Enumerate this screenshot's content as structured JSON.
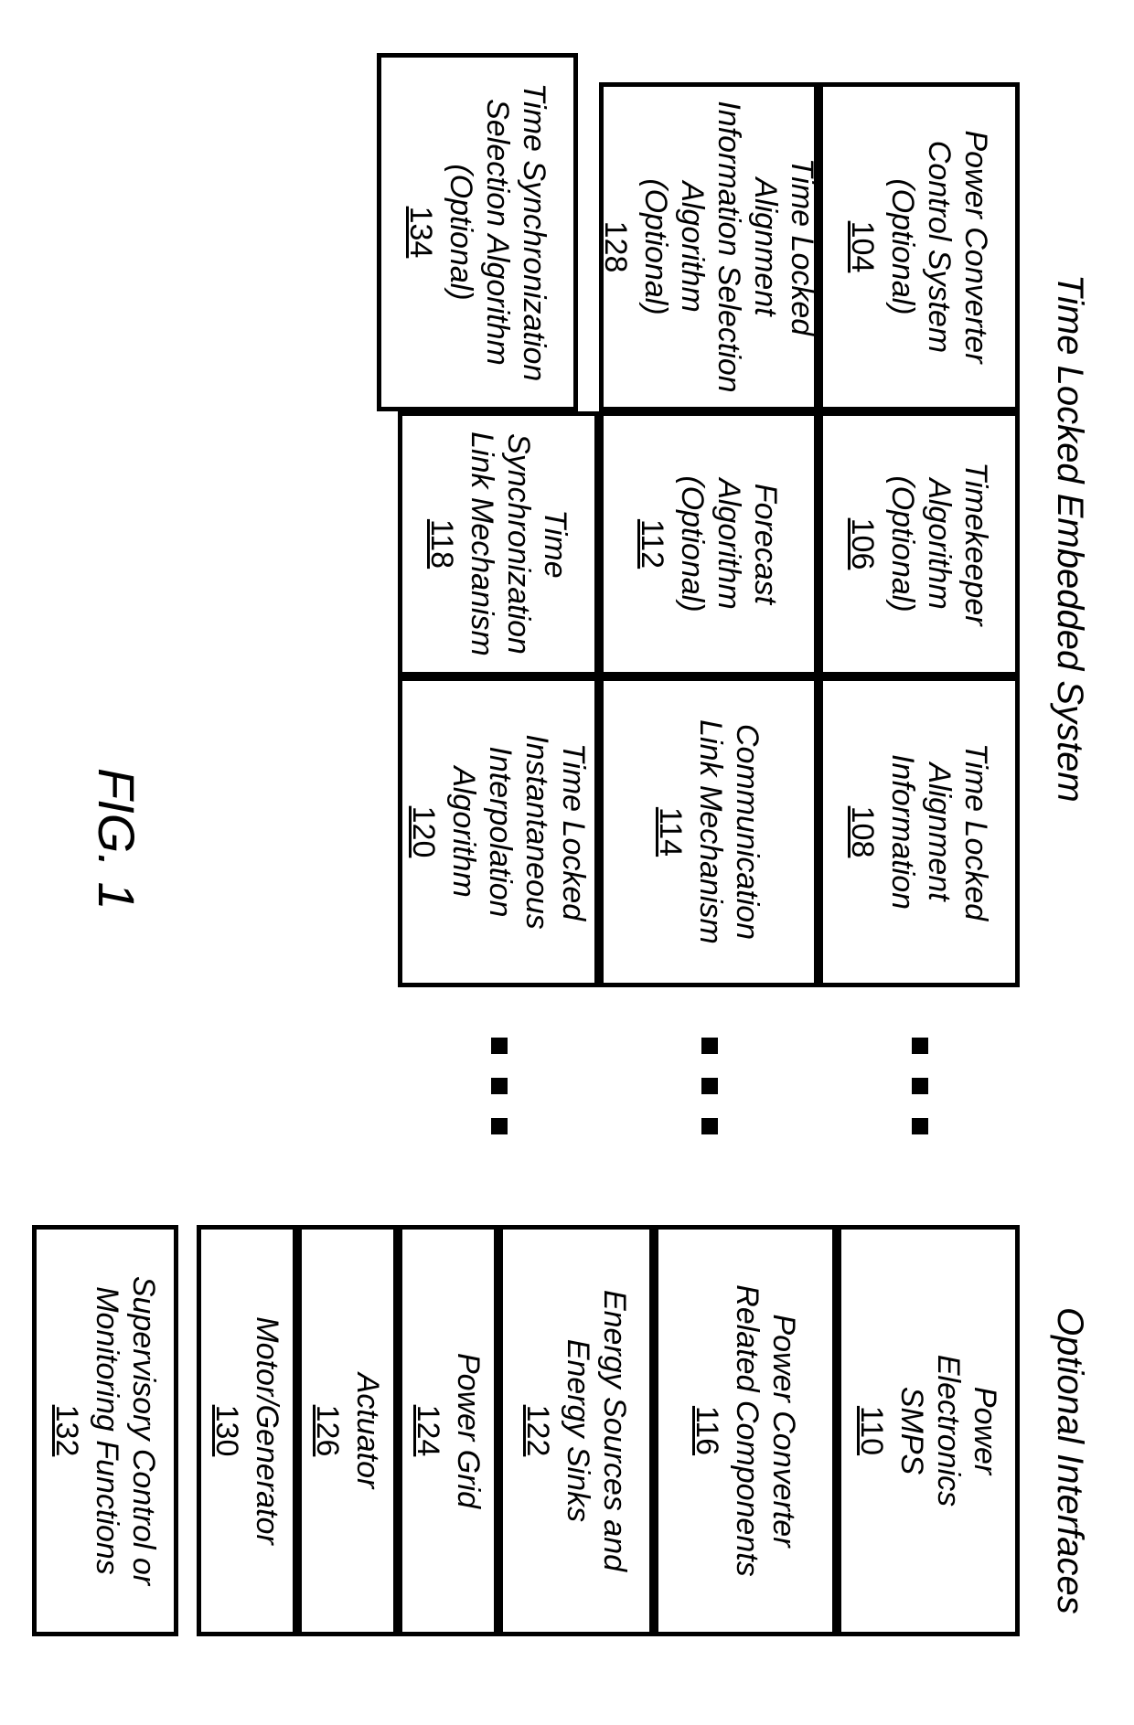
{
  "headings": {
    "left": "Time Locked Embedded System",
    "right": "Optional Interfaces"
  },
  "figure": "FIG. 1",
  "left_grid": {
    "r1c1": {
      "label": "Power Converter\nControl System\n(Optional)",
      "ref": "104"
    },
    "r1c2": {
      "label": "Timekeeper\nAlgorithm\n(Optional)",
      "ref": "106"
    },
    "r1c3": {
      "label": "Time Locked\nAlignment Information",
      "ref": "108"
    },
    "r2c1": {
      "label": "Time Locked Alignment\nInformation Selection\nAlgorithm\n(Optional)",
      "ref": "128"
    },
    "r2c2": {
      "label": "Forecast\nAlgorithm\n(Optional)",
      "ref": "112"
    },
    "r2c3": {
      "label": "Communication\nLink Mechanism",
      "ref": "114"
    },
    "r3c1": {
      "label": "Time Synchronization\nSelection Algorithm\n(Optional)",
      "ref": "134"
    },
    "r3c2": {
      "label": "Time Synchronization\nLink Mechanism",
      "ref": "118"
    },
    "r3c3": {
      "label": "Time Locked\nInstantaneous\nInterpolation Algorithm",
      "ref": "120"
    }
  },
  "right_col": {
    "b1": {
      "label": "Power\nElectronics\nSMPS",
      "ref": "110"
    },
    "b2": {
      "label": "Power Converter\nRelated Components",
      "ref": "116"
    },
    "b3": {
      "label": "Energy Sources and\nEnergy Sinks",
      "ref": "122"
    },
    "b4": {
      "label": "Power Grid",
      "ref": "124"
    },
    "b5": {
      "label": "Actuator",
      "ref": "126"
    },
    "b6": {
      "label": "Motor/Generator",
      "ref": "130"
    },
    "b7": {
      "label": "Supervisory Control or\nMonitoring Functions",
      "ref": "132"
    }
  }
}
